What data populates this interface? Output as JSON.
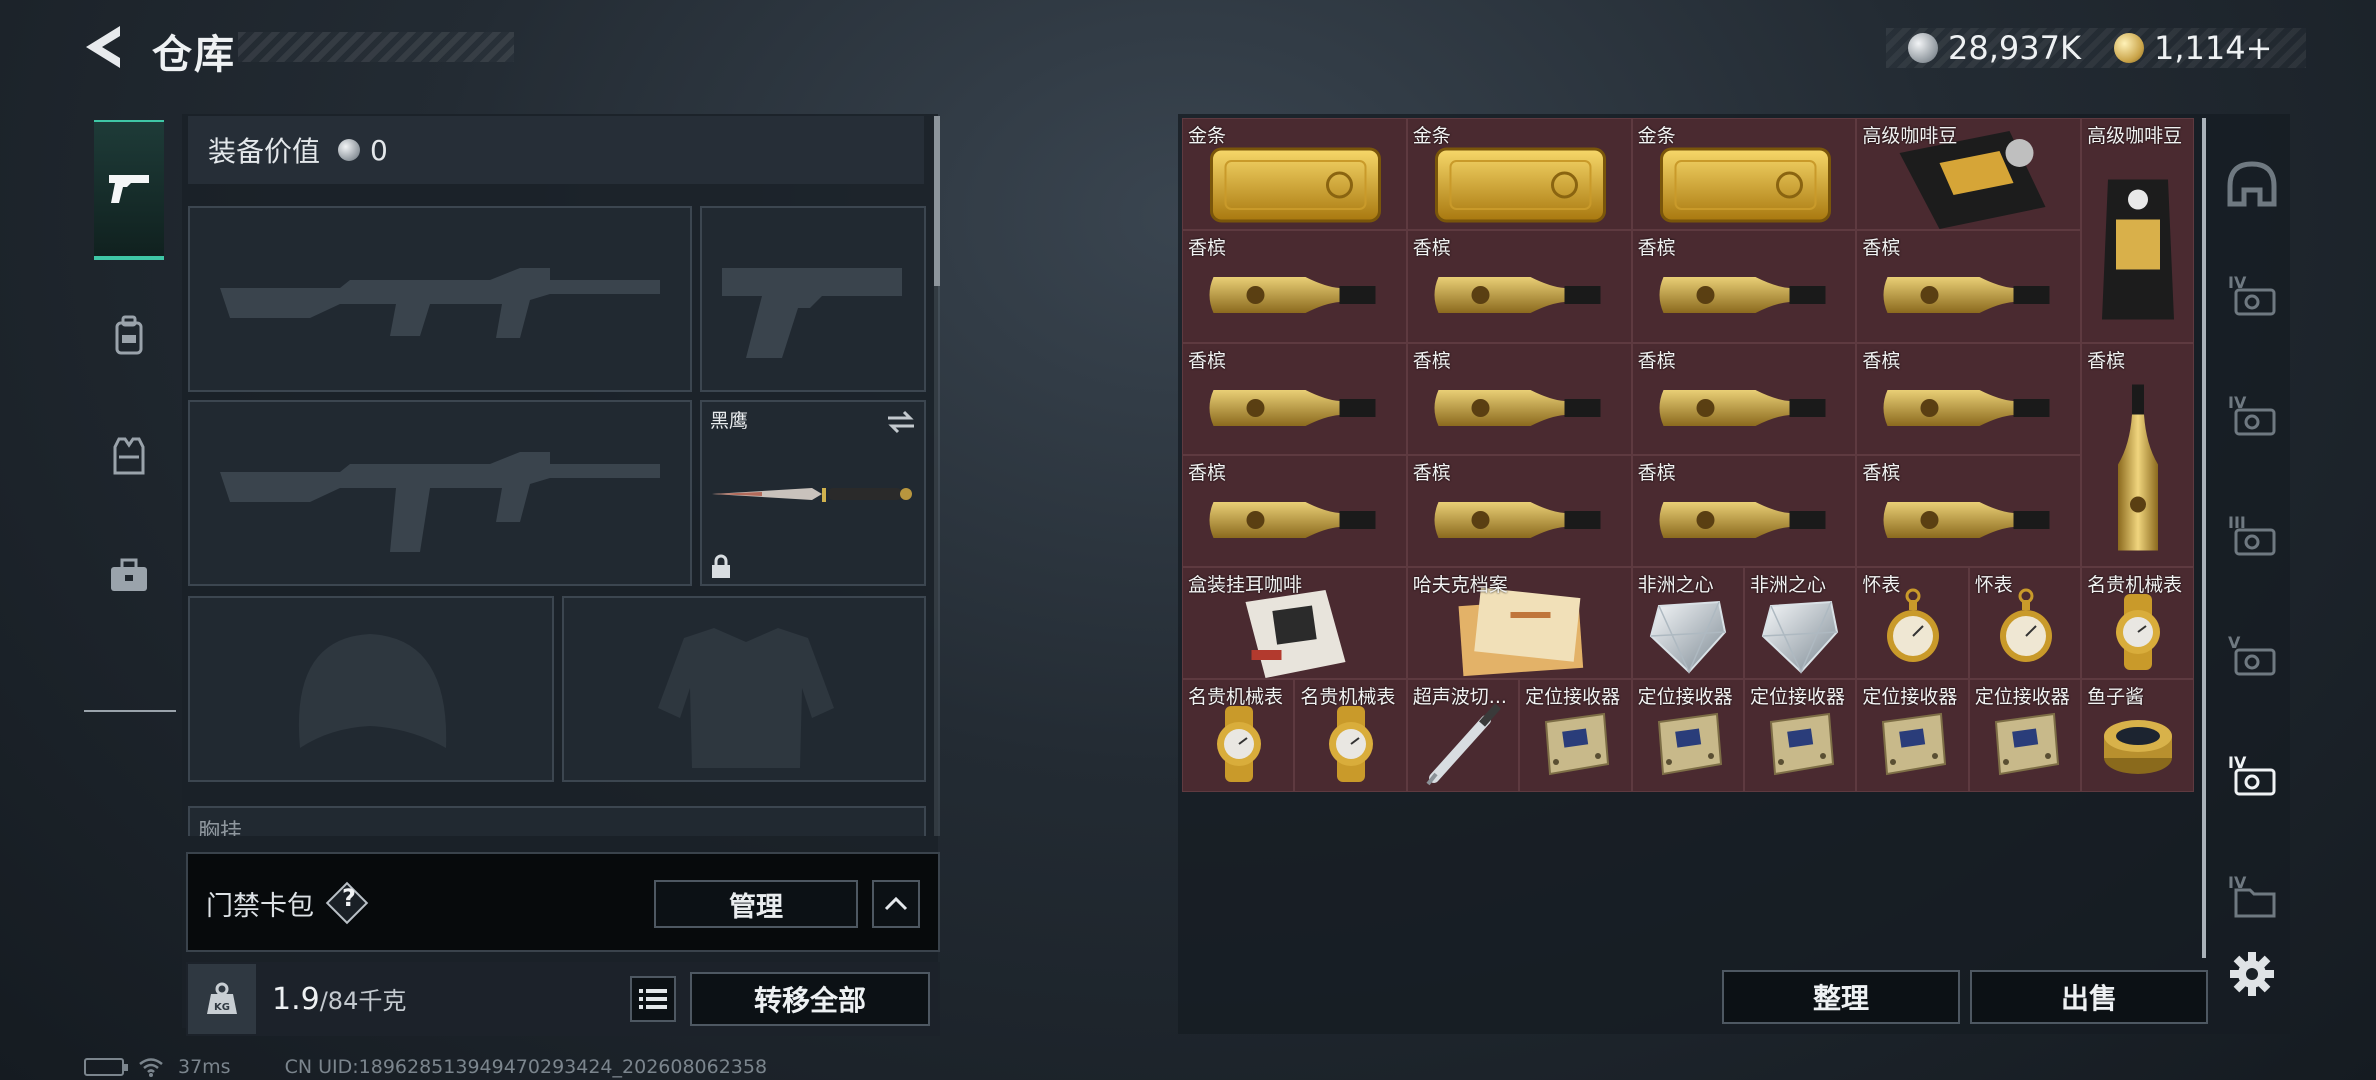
{
  "header": {
    "title": "仓库",
    "silver_amount": "28,937K",
    "gold_amount": "1,114+"
  },
  "side_tabs": [
    "pistol-icon",
    "backpack-icon",
    "vest-icon",
    "toolbox-icon"
  ],
  "equipment": {
    "value_label": "装备价值",
    "value_amount": "0",
    "knife_slot_label": "黑鹰",
    "partial_label": "胸挂"
  },
  "card_pack": {
    "label": "门禁卡包",
    "help": "?",
    "manage_label": "管理"
  },
  "weight": {
    "current": "1.9",
    "max": "/84千克"
  },
  "transfer_all_label": "转移全部",
  "status_bar": {
    "ping": "37ms",
    "uid": "CN UID:18962851394947029342​4_202608062358"
  },
  "stash": {
    "items": [
      {
        "name": "金条",
        "icon": "gold-bar"
      },
      {
        "name": "金条",
        "icon": "gold-bar"
      },
      {
        "name": "金条",
        "icon": "gold-bar"
      },
      {
        "name": "高级咖啡豆",
        "icon": "coffee-bag"
      },
      {
        "name": "高级咖啡豆",
        "icon": "coffee-bag-tall"
      },
      {
        "name": "香槟",
        "icon": "champagne"
      },
      {
        "name": "香槟",
        "icon": "champagne"
      },
      {
        "name": "香槟",
        "icon": "champagne"
      },
      {
        "name": "香槟",
        "icon": "champagne"
      },
      {
        "name": "香槟",
        "icon": "champagne"
      },
      {
        "name": "香槟",
        "icon": "champagne"
      },
      {
        "name": "香槟",
        "icon": "champagne"
      },
      {
        "name": "香槟",
        "icon": "champagne"
      },
      {
        "name": "香槟",
        "icon": "champagne-upright"
      },
      {
        "name": "香槟",
        "icon": "champagne"
      },
      {
        "name": "香槟",
        "icon": "champagne"
      },
      {
        "name": "香槟",
        "icon": "champagne"
      },
      {
        "name": "香槟",
        "icon": "champagne"
      },
      {
        "name": "盒装挂耳咖啡",
        "icon": "coffee-box"
      },
      {
        "name": "哈夫克档案",
        "icon": "document"
      },
      {
        "name": "非洲之心",
        "icon": "diamond"
      },
      {
        "name": "非洲之心",
        "icon": "diamond"
      },
      {
        "name": "怀表",
        "icon": "pocket-watch"
      },
      {
        "name": "怀表",
        "icon": "pocket-watch"
      },
      {
        "name": "名贵机械表",
        "icon": "wristwatch"
      },
      {
        "name": "名贵机械表",
        "icon": "wristwatch"
      },
      {
        "name": "名贵机械表",
        "icon": "wristwatch"
      },
      {
        "name": "超声波切...",
        "icon": "ultrasonic-cutter"
      },
      {
        "name": "定位接收器",
        "icon": "locator"
      },
      {
        "name": "定位接收器",
        "icon": "locator"
      },
      {
        "name": "定位接收器",
        "icon": "locator"
      },
      {
        "name": "定位接收器",
        "icon": "locator"
      },
      {
        "name": "定位接收器",
        "icon": "locator"
      },
      {
        "name": "鱼子酱",
        "icon": "caviar"
      }
    ],
    "categories": [
      "helmet-icon",
      "case-iv-icon",
      "case-iv-icon",
      "case-iii-icon",
      "case-v-icon",
      "case-iv-icon",
      "folder-iv-icon"
    ],
    "sort_label": "整理",
    "sell_label": "出售"
  },
  "colors": {
    "accent": "#3fc7a6",
    "rare_cell": "#4a2a30"
  }
}
